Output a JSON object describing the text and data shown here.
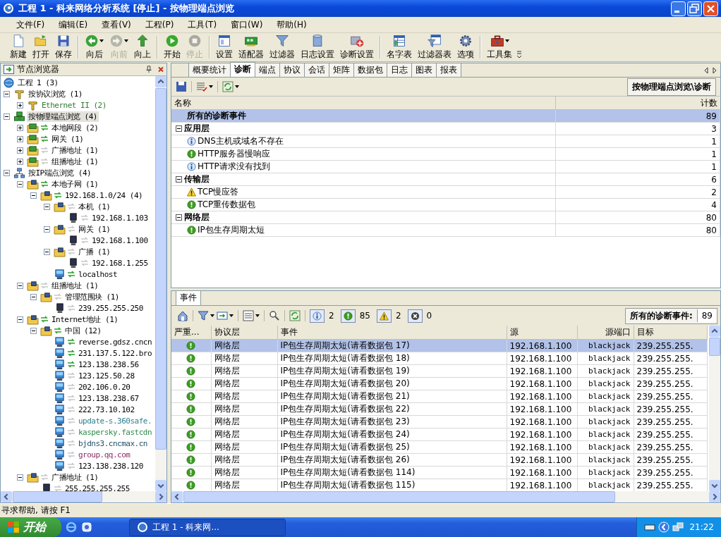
{
  "window": {
    "title": "工程 1 - 科来网络分析系统 [停止] - 按物理端点浏览"
  },
  "menu": [
    "文件(F)",
    "编辑(E)",
    "查看(V)",
    "工程(P)",
    "工具(T)",
    "窗口(W)",
    "帮助(H)"
  ],
  "toolbar": [
    {
      "buttons": [
        {
          "label": "新建",
          "kind": "new",
          "disabled": false,
          "dropdown": false
        },
        {
          "label": "打开",
          "kind": "open",
          "disabled": false,
          "dropdown": false
        },
        {
          "label": "保存",
          "kind": "save",
          "disabled": false,
          "dropdown": false
        }
      ]
    },
    {
      "buttons": [
        {
          "label": "向后",
          "kind": "back",
          "disabled": false,
          "dropdown": true
        },
        {
          "label": "向前",
          "kind": "forward",
          "disabled": true,
          "dropdown": true
        },
        {
          "label": "向上",
          "kind": "up",
          "disabled": false,
          "dropdown": false
        }
      ]
    },
    {
      "buttons": [
        {
          "label": "开始",
          "kind": "start",
          "disabled": false,
          "dropdown": false
        },
        {
          "label": "停止",
          "kind": "stop",
          "disabled": true,
          "dropdown": false
        }
      ]
    },
    {
      "buttons": [
        {
          "label": "设置",
          "kind": "settings",
          "disabled": false,
          "dropdown": false
        },
        {
          "label": "适配器",
          "kind": "adapter",
          "disabled": false,
          "dropdown": false
        },
        {
          "label": "过滤器",
          "kind": "filter",
          "disabled": false,
          "dropdown": false
        },
        {
          "label": "日志设置",
          "kind": "log",
          "disabled": false,
          "dropdown": false
        },
        {
          "label": "诊断设置",
          "kind": "diag",
          "disabled": false,
          "dropdown": false
        }
      ]
    },
    {
      "buttons": [
        {
          "label": "名字表",
          "kind": "names",
          "disabled": false,
          "dropdown": false
        },
        {
          "label": "过滤器表",
          "kind": "filtertable",
          "disabled": false,
          "dropdown": false
        },
        {
          "label": "选项",
          "kind": "options",
          "disabled": false,
          "dropdown": false
        }
      ]
    },
    {
      "buttons": [
        {
          "label": "工具集",
          "kind": "tools",
          "disabled": false,
          "dropdown": true
        }
      ]
    }
  ],
  "node_browser": {
    "title": "节点浏览器",
    "tree": [
      {
        "label": "工程 1 (3)",
        "kind": "project",
        "selected": false,
        "children": [
          {
            "label": "按协议浏览 (1)",
            "kind": "protocol",
            "selected": false,
            "expanded": true,
            "children": [
              {
                "label": "Ethernet II (2)",
                "kind": "protocol",
                "selected": false,
                "expanded": false,
                "color": "#2e7d32"
              }
            ]
          },
          {
            "label": "按物理端点浏览 (4)",
            "kind": "physical",
            "selected": true,
            "expanded": true,
            "children": [
              {
                "label": "本地网段 (2)",
                "kind": "segment",
                "traffic": true,
                "selected": false,
                "expanded": false
              },
              {
                "label": "网关 (1)",
                "kind": "segment",
                "traffic": true,
                "selected": false,
                "expanded": false
              },
              {
                "label": "广播地址 (1)",
                "kind": "segment",
                "traffic": false,
                "selected": false,
                "expanded": false
              },
              {
                "label": "组播地址 (1)",
                "kind": "segment",
                "traffic": false,
                "selected": false,
                "expanded": false
              }
            ]
          },
          {
            "label": "按IP端点浏览 (4)",
            "kind": "ipview",
            "selected": false,
            "expanded": true,
            "children": [
              {
                "label": "本地子网 (1)",
                "kind": "folder",
                "traffic": true,
                "selected": false,
                "expanded": true,
                "children": [
                  {
                    "label": "192.168.1.0/24 (4)",
                    "kind": "folder",
                    "traffic": true,
                    "selected": false,
                    "expanded": true,
                    "children": [
                      {
                        "label": "本机 (1)",
                        "kind": "folder",
                        "traffic": false,
                        "selected": false,
                        "expanded": true,
                        "children": [
                          {
                            "label": "192.168.1.103",
                            "kind": "monitor",
                            "traffic": false,
                            "selected": false
                          }
                        ]
                      },
                      {
                        "label": "网关 (1)",
                        "kind": "folder",
                        "traffic": false,
                        "selected": false,
                        "expanded": true,
                        "children": [
                          {
                            "label": "192.168.1.100",
                            "kind": "monitor",
                            "traffic": false,
                            "selected": false
                          }
                        ]
                      },
                      {
                        "label": "广播 (1)",
                        "kind": "folder",
                        "traffic": false,
                        "selected": false,
                        "expanded": true,
                        "children": [
                          {
                            "label": "192.168.1.255",
                            "kind": "monitor",
                            "traffic": false,
                            "selected": false
                          }
                        ]
                      },
                      {
                        "label": "localhost",
                        "kind": "monitor-blue",
                        "traffic": true,
                        "selected": false
                      }
                    ]
                  }
                ]
              },
              {
                "label": "组播地址 (1)",
                "kind": "folder",
                "traffic": false,
                "selected": false,
                "expanded": true,
                "children": [
                  {
                    "label": "管理范围块 (1)",
                    "kind": "folder",
                    "traffic": false,
                    "selected": false,
                    "expanded": true,
                    "children": [
                      {
                        "label": "239.255.255.250",
                        "kind": "monitor",
                        "traffic": false,
                        "selected": false
                      }
                    ]
                  }
                ]
              },
              {
                "label": "Internet地址 (1)",
                "kind": "folder",
                "traffic": true,
                "selected": false,
                "expanded": true,
                "children": [
                  {
                    "label": "中国 (12)",
                    "kind": "folder",
                    "traffic": true,
                    "selected": false,
                    "expanded": true,
                    "children": [
                      {
                        "label": "reverse.gdsz.cncn",
                        "kind": "monitor-blue",
                        "traffic": true,
                        "selected": false
                      },
                      {
                        "label": "231.137.5.122.bro",
                        "kind": "monitor-blue",
                        "traffic": true,
                        "selected": false
                      },
                      {
                        "label": "123.138.238.56",
                        "kind": "monitor-blue",
                        "traffic": true,
                        "selected": false
                      },
                      {
                        "label": "123.125.50.28",
                        "kind": "monitor-blue",
                        "traffic": false,
                        "selected": false
                      },
                      {
                        "label": "202.106.0.20",
                        "kind": "monitor-blue",
                        "traffic": false,
                        "selected": false
                      },
                      {
                        "label": "123.138.238.67",
                        "kind": "monitor-blue",
                        "traffic": false,
                        "selected": false
                      },
                      {
                        "label": "222.73.10.102",
                        "kind": "monitor-blue",
                        "traffic": false,
                        "selected": false
                      },
                      {
                        "label": "update-s.360safe.",
                        "kind": "monitor-blue",
                        "traffic": false,
                        "selected": false,
                        "color": "#2a7f8f"
                      },
                      {
                        "label": "kaspersky.fastcdn",
                        "kind": "monitor-blue",
                        "traffic": false,
                        "selected": false,
                        "color": "#2e8b4a"
                      },
                      {
                        "label": "bjdns3.cncmax.cn",
                        "kind": "monitor-blue",
                        "traffic": false,
                        "selected": false,
                        "color": "#1f4f66"
                      },
                      {
                        "label": "group.qq.com",
                        "kind": "monitor-blue",
                        "traffic": false,
                        "selected": false,
                        "color": "#8b2c6a"
                      },
                      {
                        "label": "123.138.238.120",
                        "kind": "monitor-blue",
                        "traffic": false,
                        "selected": false
                      }
                    ]
                  }
                ]
              },
              {
                "label": "广播地址 (1)",
                "kind": "folder",
                "traffic": false,
                "selected": false,
                "expanded": true,
                "children": [
                  {
                    "label": "255.255.255.255",
                    "kind": "monitor",
                    "traffic": false,
                    "selected": false
                  }
                ]
              }
            ]
          }
        ]
      }
    ]
  },
  "tabs": [
    {
      "label": "概要统计",
      "selected": false
    },
    {
      "label": "诊断",
      "selected": true
    },
    {
      "label": "端点",
      "selected": false
    },
    {
      "label": "协议",
      "selected": false
    },
    {
      "label": "会话",
      "selected": false
    },
    {
      "label": "矩阵",
      "selected": false
    },
    {
      "label": "数据包",
      "selected": false
    },
    {
      "label": "日志",
      "selected": false
    },
    {
      "label": "图表",
      "selected": false
    },
    {
      "label": "报表",
      "selected": false
    }
  ],
  "path_button": "按物理端点浏览\\诊断",
  "diagnosis_table": {
    "columns": [
      "名称",
      "计数"
    ],
    "rows": [
      {
        "kind": "total",
        "name": "所有的诊断事件",
        "count": "89",
        "selected": true
      },
      {
        "kind": "group",
        "name": "应用层",
        "count": "3",
        "expanded": true,
        "selected": false
      },
      {
        "kind": "info",
        "name": "DNS主机或域名不存在",
        "count": "1",
        "selected": false
      },
      {
        "kind": "notice",
        "name": "HTTP服务器慢响应",
        "count": "1",
        "selected": false
      },
      {
        "kind": "info",
        "name": "HTTP请求没有找到",
        "count": "1",
        "selected": false
      },
      {
        "kind": "group",
        "name": "传输层",
        "count": "6",
        "expanded": true,
        "selected": false
      },
      {
        "kind": "warning",
        "name": "TCP慢应答",
        "count": "2",
        "selected": false
      },
      {
        "kind": "notice",
        "name": "TCP重传数据包",
        "count": "4",
        "selected": false
      },
      {
        "kind": "group",
        "name": "网络层",
        "count": "80",
        "expanded": true,
        "selected": false
      },
      {
        "kind": "notice",
        "name": "IP包生存周期太短",
        "count": "80",
        "selected": false
      }
    ]
  },
  "events": {
    "tab": "事件",
    "counters": [
      {
        "kind": "info",
        "count": "2"
      },
      {
        "kind": "notice",
        "count": "85"
      },
      {
        "kind": "warning",
        "count": "2"
      },
      {
        "kind": "error",
        "count": "0"
      }
    ],
    "total_label": "所有的诊断事件:",
    "total": "89",
    "columns": [
      "严重...",
      "协议层",
      "事件",
      "源",
      "源端口",
      "目标"
    ],
    "rows": [
      {
        "kind": "notice",
        "layer": "网络层",
        "event": "IP包生存周期太短(请看数据包 17)",
        "source": "192.168.1.100",
        "port": "blackjack",
        "target": "239.255.255.",
        "selected": true
      },
      {
        "kind": "notice",
        "layer": "网络层",
        "event": "IP包生存周期太短(请看数据包 18)",
        "source": "192.168.1.100",
        "port": "blackjack",
        "target": "239.255.255.",
        "selected": false
      },
      {
        "kind": "notice",
        "layer": "网络层",
        "event": "IP包生存周期太短(请看数据包 19)",
        "source": "192.168.1.100",
        "port": "blackjack",
        "target": "239.255.255.",
        "selected": false
      },
      {
        "kind": "notice",
        "layer": "网络层",
        "event": "IP包生存周期太短(请看数据包 20)",
        "source": "192.168.1.100",
        "port": "blackjack",
        "target": "239.255.255.",
        "selected": false
      },
      {
        "kind": "notice",
        "layer": "网络层",
        "event": "IP包生存周期太短(请看数据包 21)",
        "source": "192.168.1.100",
        "port": "blackjack",
        "target": "239.255.255.",
        "selected": false
      },
      {
        "kind": "notice",
        "layer": "网络层",
        "event": "IP包生存周期太短(请看数据包 22)",
        "source": "192.168.1.100",
        "port": "blackjack",
        "target": "239.255.255.",
        "selected": false
      },
      {
        "kind": "notice",
        "layer": "网络层",
        "event": "IP包生存周期太短(请看数据包 23)",
        "source": "192.168.1.100",
        "port": "blackjack",
        "target": "239.255.255.",
        "selected": false
      },
      {
        "kind": "notice",
        "layer": "网络层",
        "event": "IP包生存周期太短(请看数据包 24)",
        "source": "192.168.1.100",
        "port": "blackjack",
        "target": "239.255.255.",
        "selected": false
      },
      {
        "kind": "notice",
        "layer": "网络层",
        "event": "IP包生存周期太短(请看数据包 25)",
        "source": "192.168.1.100",
        "port": "blackjack",
        "target": "239.255.255.",
        "selected": false
      },
      {
        "kind": "notice",
        "layer": "网络层",
        "event": "IP包生存周期太短(请看数据包 26)",
        "source": "192.168.1.100",
        "port": "blackjack",
        "target": "239.255.255.",
        "selected": false
      },
      {
        "kind": "notice",
        "layer": "网络层",
        "event": "IP包生存周期太短(请看数据包 114)",
        "source": "192.168.1.100",
        "port": "blackjack",
        "target": "239.255.255.",
        "selected": false
      },
      {
        "kind": "notice",
        "layer": "网络层",
        "event": "IP包生存周期太短(请看数据包 115)",
        "source": "192.168.1.100",
        "port": "blackjack",
        "target": "239.255.255.",
        "selected": false
      }
    ]
  },
  "status_bar": "寻求帮助, 请按 F1",
  "taskbar": {
    "start": "开始",
    "task": "工程 1 - 科来网...",
    "time": "21:22"
  }
}
